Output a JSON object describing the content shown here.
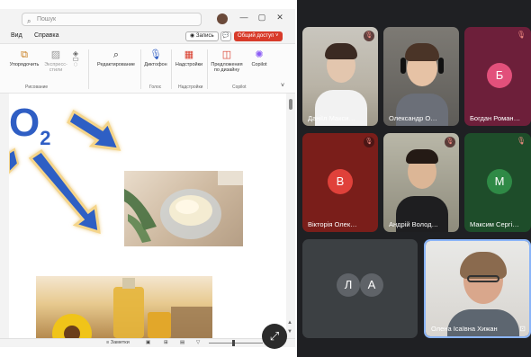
{
  "ppt": {
    "search_placeholder": "Пошук",
    "tabs": [
      "Вид",
      "Справка"
    ],
    "record_label": "Запись",
    "share_label": "Общий доступ",
    "ribbon": {
      "items": [
        {
          "label": "Упорядочить",
          "icon": "arrange-icon"
        },
        {
          "label": "Экспресс-стили",
          "icon": "quick-styles-icon"
        },
        {
          "label": "Редактирование",
          "icon": "find-icon"
        },
        {
          "label": "Диктофон",
          "icon": "microphone-icon"
        },
        {
          "label": "Надстройки",
          "icon": "addins-icon"
        },
        {
          "label": "Предложения по дизайну",
          "icon": "designer-icon"
        },
        {
          "label": "Copilot",
          "icon": "copilot-icon"
        }
      ],
      "groups": [
        "Рисование",
        "Голос",
        "Надстройки",
        "Copilot"
      ]
    },
    "slide": {
      "formula": "O",
      "formula_sub": "2"
    },
    "status": {
      "notes_label": "Заметки"
    },
    "colors": {
      "share": "#d83b2a",
      "accent": "#2f5ec4"
    }
  },
  "meet": {
    "participants": [
      {
        "name": "Даніїл Макси…",
        "type": "video",
        "muted": true
      },
      {
        "name": "Олександр О…",
        "type": "video",
        "muted": false
      },
      {
        "name": "Богдан Роман…",
        "type": "avatar",
        "initial": "Б",
        "bg": "#6d1f3a",
        "circle": "#e2507b",
        "muted": true
      },
      {
        "name": "Вікторія Олек…",
        "type": "avatar",
        "initial": "В",
        "bg": "#7a1e1a",
        "circle": "#e0413a",
        "muted": true
      },
      {
        "name": "Андрій Волод…",
        "type": "video",
        "muted": true
      },
      {
        "name": "Максим Сергі…",
        "type": "avatar",
        "initial": "М",
        "bg": "#1e4d2a",
        "circle": "#2f8a46",
        "muted": true
      },
      {
        "name": "",
        "type": "group",
        "initials": [
          "Л",
          "А"
        ]
      },
      {
        "name": "Олена Ісаївна Хижан",
        "type": "video",
        "muted": false
      }
    ]
  }
}
